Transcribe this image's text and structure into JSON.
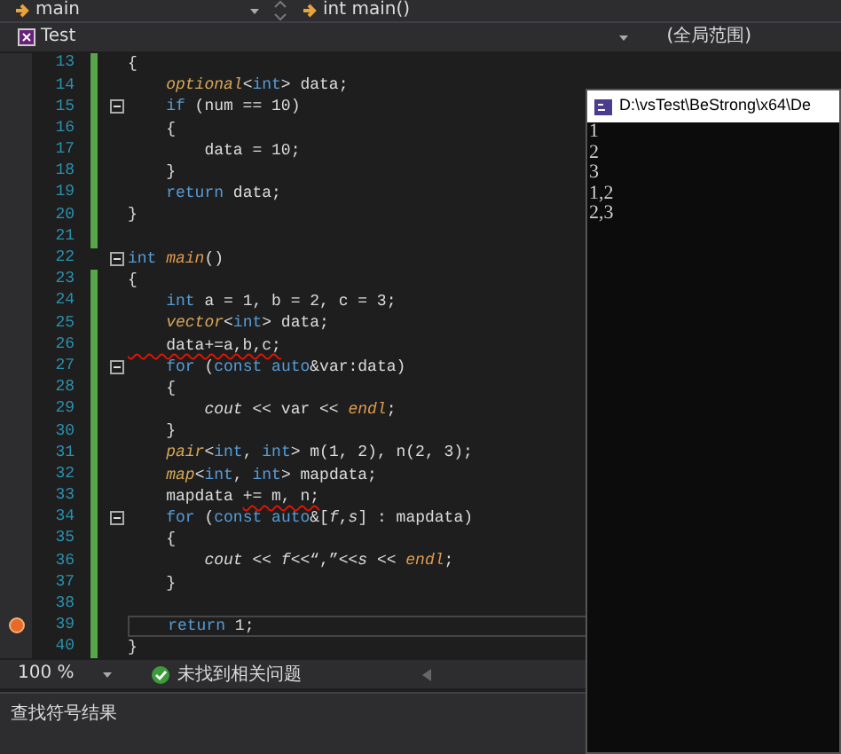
{
  "nav_bar": {
    "scope": "main",
    "member": "int main()"
  },
  "project_bar": {
    "project": "Test",
    "range": "(全局范围)"
  },
  "code_lines": [
    {
      "number": "13",
      "changed": true,
      "fold": false,
      "breakpoint": false,
      "current": false,
      "segments": [
        {
          "text": "{",
          "kind": "plain"
        }
      ]
    },
    {
      "number": "14",
      "changed": true,
      "fold": false,
      "breakpoint": false,
      "current": false,
      "segments": [
        {
          "text": "    optional",
          "kind": "type"
        },
        {
          "text": "<",
          "kind": "plain"
        },
        {
          "text": "int",
          "kind": "keyword"
        },
        {
          "text": "> data;",
          "kind": "plain"
        }
      ]
    },
    {
      "number": "15",
      "changed": true,
      "fold": true,
      "breakpoint": false,
      "current": false,
      "segments": [
        {
          "text": "    if",
          "kind": "keyword"
        },
        {
          "text": " (num == 10)",
          "kind": "plain"
        }
      ]
    },
    {
      "number": "16",
      "changed": true,
      "fold": false,
      "breakpoint": false,
      "current": false,
      "segments": [
        {
          "text": "    {",
          "kind": "plain"
        }
      ]
    },
    {
      "number": "17",
      "changed": true,
      "fold": false,
      "breakpoint": false,
      "current": false,
      "segments": [
        {
          "text": "        data = 10;",
          "kind": "plain"
        }
      ]
    },
    {
      "number": "18",
      "changed": true,
      "fold": false,
      "breakpoint": false,
      "current": false,
      "segments": [
        {
          "text": "    }",
          "kind": "plain"
        }
      ]
    },
    {
      "number": "19",
      "changed": true,
      "fold": false,
      "breakpoint": false,
      "current": false,
      "segments": [
        {
          "text": "    return",
          "kind": "keyword"
        },
        {
          "text": " data;",
          "kind": "plain"
        }
      ]
    },
    {
      "number": "20",
      "changed": true,
      "fold": false,
      "breakpoint": false,
      "current": false,
      "segments": [
        {
          "text": "}",
          "kind": "plain"
        }
      ]
    },
    {
      "number": "21",
      "changed": true,
      "fold": false,
      "breakpoint": false,
      "current": false
    },
    {
      "number": "22",
      "changed": false,
      "fold": true,
      "breakpoint": false,
      "current": false,
      "segments": [
        {
          "text": "int",
          "kind": "keyword"
        },
        {
          "text": " main",
          "kind": "func"
        },
        {
          "text": "()",
          "kind": "plain"
        }
      ]
    },
    {
      "number": "23",
      "changed": true,
      "fold": false,
      "breakpoint": false,
      "current": false,
      "segments": [
        {
          "text": "{",
          "kind": "plain"
        }
      ]
    },
    {
      "number": "24",
      "changed": true,
      "fold": false,
      "breakpoint": false,
      "current": false,
      "segments": [
        {
          "text": "    int",
          "kind": "keyword"
        },
        {
          "text": " a = 1, b = 2, c = 3;",
          "kind": "plain"
        }
      ]
    },
    {
      "number": "25",
      "changed": true,
      "fold": false,
      "breakpoint": false,
      "current": false,
      "segments": [
        {
          "text": "    vector",
          "kind": "type"
        },
        {
          "text": "<",
          "kind": "plain"
        },
        {
          "text": "int",
          "kind": "keyword"
        },
        {
          "text": "> data;",
          "kind": "plain"
        }
      ]
    },
    {
      "number": "26",
      "changed": true,
      "fold": false,
      "breakpoint": false,
      "current": false,
      "segments": [
        {
          "text": "    data+=a,b,c;",
          "kind": "error"
        }
      ]
    },
    {
      "number": "27",
      "changed": true,
      "fold": true,
      "breakpoint": false,
      "current": false,
      "segments": [
        {
          "text": "    for",
          "kind": "keyword"
        },
        {
          "text": " (",
          "kind": "plain"
        },
        {
          "text": "const",
          "kind": "keyword"
        },
        {
          "text": " auto",
          "kind": "keyword"
        },
        {
          "text": "&var:data)",
          "kind": "plain"
        }
      ]
    },
    {
      "number": "28",
      "changed": true,
      "fold": false,
      "breakpoint": false,
      "current": false,
      "segments": [
        {
          "text": "    {",
          "kind": "plain"
        }
      ]
    },
    {
      "number": "29",
      "changed": true,
      "fold": false,
      "breakpoint": false,
      "current": false,
      "segments": [
        {
          "text": "        cout",
          "kind": "ident"
        },
        {
          "text": " << var << ",
          "kind": "plain"
        },
        {
          "text": "endl",
          "kind": "func"
        },
        {
          "text": ";",
          "kind": "plain"
        }
      ]
    },
    {
      "number": "30",
      "changed": true,
      "fold": false,
      "breakpoint": false,
      "current": false,
      "segments": [
        {
          "text": "    }",
          "kind": "plain"
        }
      ]
    },
    {
      "number": "31",
      "changed": true,
      "fold": false,
      "breakpoint": false,
      "current": false,
      "segments": [
        {
          "text": "    pair",
          "kind": "type"
        },
        {
          "text": "<",
          "kind": "plain"
        },
        {
          "text": "int",
          "kind": "keyword"
        },
        {
          "text": ", ",
          "kind": "plain"
        },
        {
          "text": "int",
          "kind": "keyword"
        },
        {
          "text": "> m(1, 2), n(2, 3);",
          "kind": "plain"
        }
      ]
    },
    {
      "number": "32",
      "changed": true,
      "fold": false,
      "breakpoint": false,
      "current": false,
      "segments": [
        {
          "text": "    map",
          "kind": "type"
        },
        {
          "text": "<",
          "kind": "plain"
        },
        {
          "text": "int",
          "kind": "keyword"
        },
        {
          "text": ", ",
          "kind": "plain"
        },
        {
          "text": "int",
          "kind": "keyword"
        },
        {
          "text": "> mapdata;",
          "kind": "plain"
        }
      ]
    },
    {
      "number": "33",
      "changed": true,
      "fold": false,
      "breakpoint": false,
      "current": false,
      "segments": [
        {
          "text": "    mapdata ",
          "kind": "plain"
        },
        {
          "text": "+= m, n;",
          "kind": "error"
        }
      ]
    },
    {
      "number": "34",
      "changed": true,
      "fold": true,
      "breakpoint": false,
      "current": false,
      "segments": [
        {
          "text": "    for",
          "kind": "keyword"
        },
        {
          "text": " (",
          "kind": "plain"
        },
        {
          "text": "const",
          "kind": "keyword"
        },
        {
          "text": " auto",
          "kind": "keyword"
        },
        {
          "text": "&[",
          "kind": "plain"
        },
        {
          "text": "f",
          "kind": "ident"
        },
        {
          "text": ",",
          "kind": "plain"
        },
        {
          "text": "s",
          "kind": "ident"
        },
        {
          "text": "] : mapdata)",
          "kind": "plain"
        }
      ]
    },
    {
      "number": "35",
      "changed": true,
      "fold": false,
      "breakpoint": false,
      "current": false,
      "segments": [
        {
          "text": "    {",
          "kind": "plain"
        }
      ]
    },
    {
      "number": "36",
      "changed": true,
      "fold": false,
      "breakpoint": false,
      "current": false,
      "segments": [
        {
          "text": "        cout",
          "kind": "ident"
        },
        {
          "text": " << ",
          "kind": "plain"
        },
        {
          "text": "f",
          "kind": "ident"
        },
        {
          "text": "<<“,”<<",
          "kind": "plain"
        },
        {
          "text": "s",
          "kind": "ident"
        },
        {
          "text": " << ",
          "kind": "plain"
        },
        {
          "text": "endl",
          "kind": "func"
        },
        {
          "text": ";",
          "kind": "plain"
        }
      ]
    },
    {
      "number": "37",
      "changed": true,
      "fold": false,
      "breakpoint": false,
      "current": false,
      "segments": [
        {
          "text": "    }",
          "kind": "plain"
        }
      ]
    },
    {
      "number": "38",
      "changed": true,
      "fold": false,
      "breakpoint": false,
      "current": false
    },
    {
      "number": "39",
      "changed": true,
      "fold": false,
      "breakpoint": true,
      "current": true,
      "segments": [
        {
          "text": "    return",
          "kind": "keyword"
        },
        {
          "text": " 1;",
          "kind": "plain"
        }
      ]
    },
    {
      "number": "40",
      "changed": true,
      "fold": false,
      "breakpoint": false,
      "current": false,
      "segments": [
        {
          "text": "}",
          "kind": "plain"
        }
      ]
    }
  ],
  "status_bar": {
    "zoom": "100 %",
    "issues": "未找到相关问题"
  },
  "bottom_panel": {
    "title": "查找符号结果"
  },
  "console": {
    "title": "D:\\vsTest\\BeStrong\\x64\\De",
    "output": [
      "1",
      "2",
      "3",
      "1,2",
      "2,3"
    ]
  }
}
